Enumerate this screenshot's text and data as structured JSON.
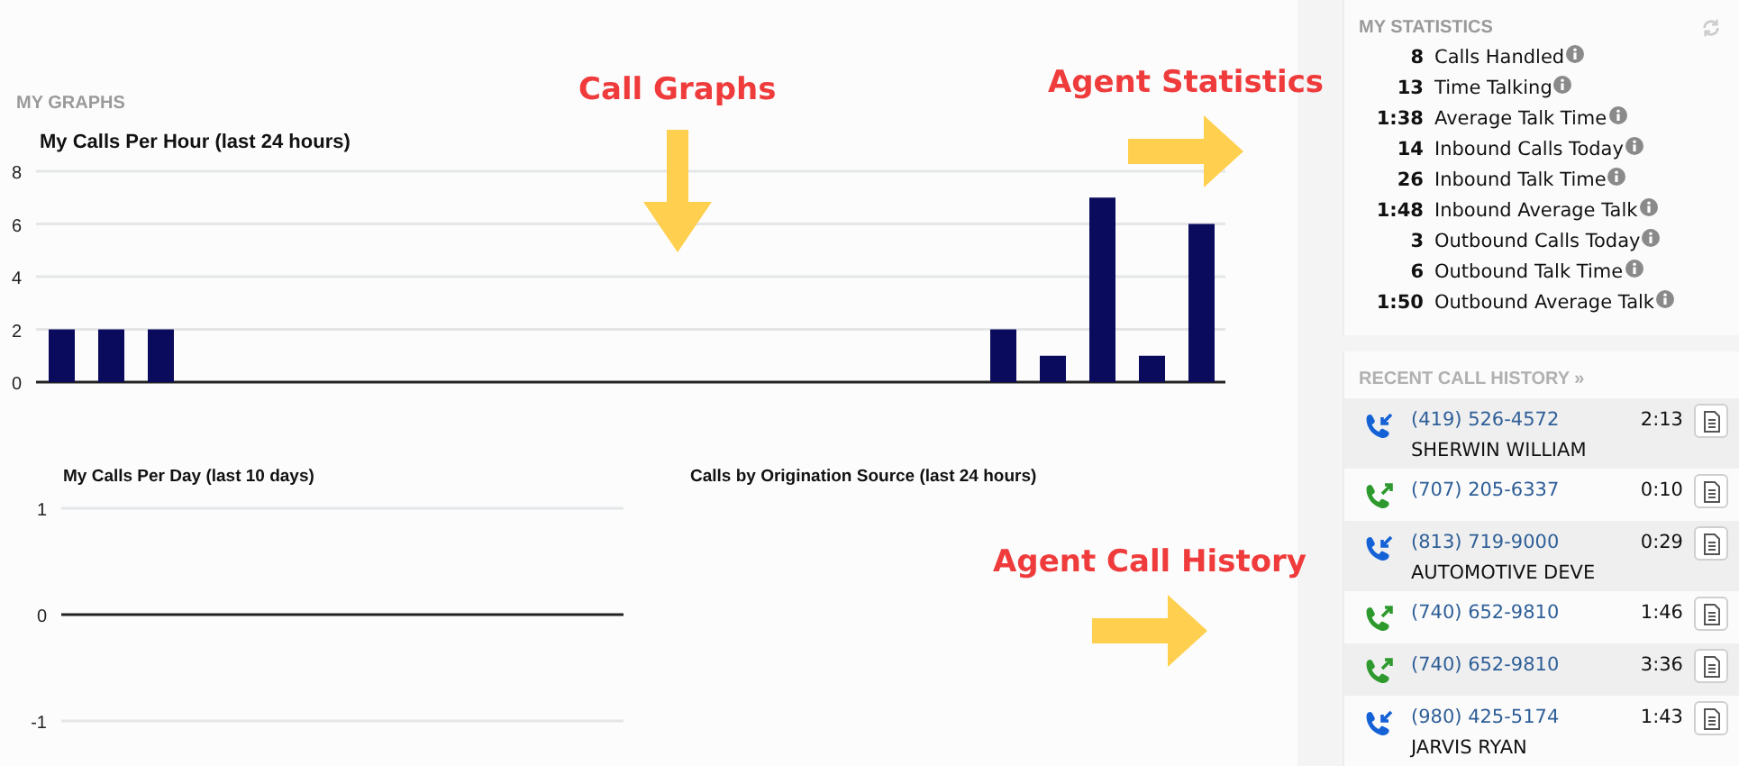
{
  "graphs": {
    "heading": "MY GRAPHS",
    "calls_per_hour": {
      "chart_data": {
        "type": "bar",
        "title": "My Calls Per Hour (last 24 hours)",
        "yticks": [
          0,
          2,
          4,
          6,
          8
        ],
        "ylim": [
          0,
          8
        ],
        "grid": true,
        "series": [
          {
            "color": "#0b0b5e",
            "values": [
              2,
              2,
              2,
              0,
              0,
              0,
              0,
              0,
              0,
              0,
              0,
              0,
              0,
              0,
              0,
              0,
              0,
              0,
              0,
              2,
              1,
              7,
              1,
              6
            ]
          }
        ]
      }
    },
    "calls_per_day": {
      "title": "My Calls Per Day (last 10 days)",
      "axis_labels": [
        "1",
        "0",
        "-1"
      ]
    },
    "by_source": {
      "title": "Calls by Origination Source (last 24 hours)"
    }
  },
  "statistics": {
    "heading": "MY STATISTICS",
    "items": [
      {
        "figure": "8",
        "name": "Calls Handled"
      },
      {
        "figure": "13",
        "name": "Time Talking"
      },
      {
        "figure": "1:38",
        "name": "Average Talk Time"
      },
      {
        "figure": "14",
        "name": "Inbound Calls Today"
      },
      {
        "figure": "26",
        "name": "Inbound Talk Time"
      },
      {
        "figure": "1:48",
        "name": "Inbound Average Talk"
      },
      {
        "figure": "3",
        "name": "Outbound Calls Today"
      },
      {
        "figure": "6",
        "name": "Outbound Talk Time"
      },
      {
        "figure": "1:50",
        "name": "Outbound Average Talk"
      }
    ]
  },
  "call_history": {
    "heading": "RECENT CALL HISTORY »",
    "calls": [
      {
        "kind": "inbound",
        "number": "(419) 526-4572",
        "name": "SHERWIN WILLIAM",
        "duration": "2:13"
      },
      {
        "kind": "outbound",
        "number": "(707) 205-6337",
        "duration": "0:10"
      },
      {
        "kind": "inbound",
        "number": "(813) 719-9000",
        "name": "AUTOMOTIVE DEVE",
        "duration": "0:29"
      },
      {
        "kind": "outbound",
        "number": "(740) 652-9810",
        "duration": "1:46"
      },
      {
        "kind": "outbound",
        "number": "(740) 652-9810",
        "duration": "3:36"
      },
      {
        "kind": "inbound",
        "number": "(980) 425-5174",
        "name": "JARVIS RYAN",
        "duration": "1:43"
      }
    ]
  },
  "annotations": [
    {
      "kind": "down",
      "text": "Call Graphs"
    },
    {
      "kind": "right",
      "text": "Agent Statistics"
    },
    {
      "kind": "right",
      "text": "Agent Call History"
    }
  ]
}
